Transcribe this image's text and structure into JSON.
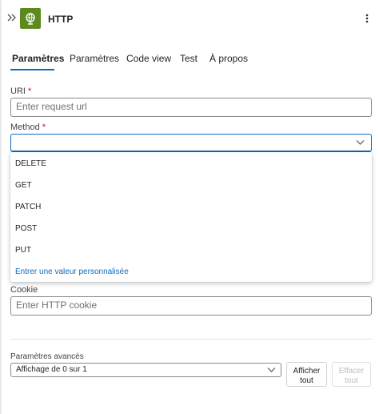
{
  "header": {
    "title": "HTTP",
    "colors": {
      "app_icon": "#5c8a1e",
      "accent": "#0f6cbd"
    }
  },
  "tabs": [
    {
      "label": "Paramètres",
      "active": true
    },
    {
      "label": "Paramètres"
    },
    {
      "label": "Code view"
    },
    {
      "label": "Test"
    },
    {
      "label": "À propos"
    }
  ],
  "form": {
    "uri": {
      "label": "URI",
      "required_mark": "*",
      "placeholder": "Enter request url"
    },
    "method": {
      "label": "Method",
      "required_mark": "*",
      "value": ""
    },
    "method_options": [
      "DELETE",
      "GET",
      "PATCH",
      "POST",
      "PUT"
    ],
    "method_custom_option": "Entrer une valeur personnalisée",
    "cookie": {
      "label": "Cookie",
      "placeholder": "Enter HTTP cookie"
    }
  },
  "advanced": {
    "label": "Paramètres avancés",
    "select_value": "Affichage de 0 sur 1",
    "show_all_line1": "Afficher",
    "show_all_line2": "tout",
    "clear_all_line1": "Effacer",
    "clear_all_line2": "tout"
  },
  "icons": [
    "collapse-chevrons-icon",
    "http-globe-icon",
    "more-vertical-icon",
    "chevron-down-icon"
  ]
}
